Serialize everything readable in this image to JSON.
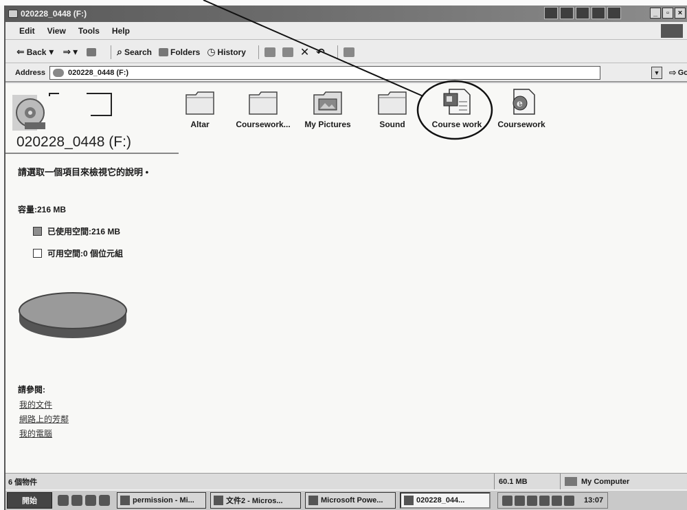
{
  "window": {
    "title": "020228_0448 (F:)"
  },
  "menu": {
    "items": [
      "Edit",
      "View",
      "Tools",
      "Help"
    ]
  },
  "toolbar": {
    "back": "Back",
    "search": "Search",
    "folders": "Folders",
    "history": "History"
  },
  "address": {
    "label": "Address",
    "value": "020228_0448 (F:)",
    "go": "Go"
  },
  "left_pane": {
    "drive_title": "020228_0448 (F:)",
    "prompt": "請選取一個項目來檢視它的說明 •",
    "capacity": "容量:216 MB",
    "used": "已使用空間:216 MB",
    "free": "可用空間:0 個位元組",
    "see_also": "請參閱:",
    "links": [
      "我的文件",
      "網路上的芳鄰",
      "我的電腦"
    ]
  },
  "items": [
    {
      "label": "Altar",
      "icon": "folder-icon"
    },
    {
      "label": "Coursework...",
      "icon": "folder-icon"
    },
    {
      "label": "My Pictures",
      "icon": "pictures-folder-icon"
    },
    {
      "label": "Sound",
      "icon": "folder-icon"
    },
    {
      "label": "Course work",
      "icon": "powerpoint-document-icon"
    },
    {
      "label": "Coursework",
      "icon": "html-document-icon"
    }
  ],
  "status": {
    "objects": "6 個物件",
    "size": "60.1 MB",
    "location": "My Computer"
  },
  "taskbar": {
    "start": "開始",
    "tasks": [
      "permission - Mi...",
      "文件2 - Micros...",
      "Microsoft Powe...",
      "020228_044..."
    ],
    "time": "13:07"
  },
  "colors": {
    "title_bar": "#5a5a5a",
    "content_bg": "#f8f8f6",
    "pie_top": "#9a9a9a",
    "pie_side": "#555555"
  }
}
